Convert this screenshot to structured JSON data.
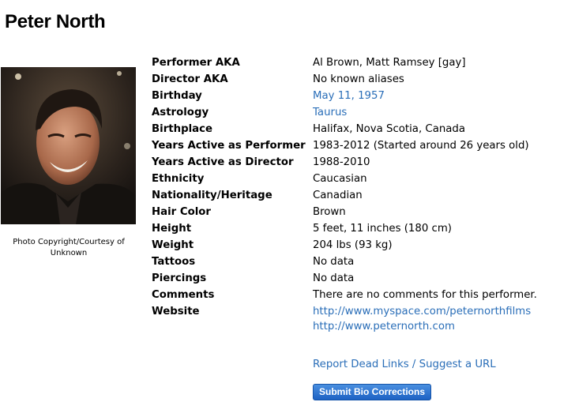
{
  "page": {
    "title": "Peter North"
  },
  "photo": {
    "caption": "Photo Copyright/Courtesy of Unknown"
  },
  "bio": [
    {
      "label": "Performer AKA",
      "value": "Al Brown, Matt Ramsey [gay]",
      "link": false
    },
    {
      "label": "Director AKA",
      "value": "No known aliases",
      "link": false
    },
    {
      "label": "Birthday",
      "value": "May 11, 1957",
      "link": true
    },
    {
      "label": "Astrology",
      "value": "Taurus",
      "link": true
    },
    {
      "label": "Birthplace",
      "value": "Halifax, Nova Scotia, Canada",
      "link": false
    },
    {
      "label": "Years Active as Performer",
      "value": "1983-2012 (Started around 26 years old)",
      "link": false
    },
    {
      "label": "Years Active as Director",
      "value": "1988-2010",
      "link": false
    },
    {
      "label": "Ethnicity",
      "value": "Caucasian",
      "link": false
    },
    {
      "label": "Nationality/Heritage",
      "value": "Canadian",
      "link": false
    },
    {
      "label": "Hair Color",
      "value": "Brown",
      "link": false
    },
    {
      "label": "Height",
      "value": "5 feet, 11 inches (180 cm)",
      "link": false
    },
    {
      "label": "Weight",
      "value": "204 lbs (93 kg)",
      "link": false
    },
    {
      "label": "Tattoos",
      "value": "No data",
      "link": false
    },
    {
      "label": "Piercings",
      "value": "No data",
      "link": false
    },
    {
      "label": "Comments",
      "value": "There are no comments for this performer.",
      "link": false
    }
  ],
  "website": {
    "label": "Website",
    "links": [
      "http://www.myspace.com/peternorthfilms",
      "http://www.peternorth.com"
    ]
  },
  "actions": {
    "report_dead_links": "Report Dead Links",
    "separator": " / ",
    "suggest_url": "Suggest a URL",
    "submit_label": "Submit Bio Corrections"
  },
  "colors": {
    "link": "#2a6eb8",
    "button": "#2f74d0"
  }
}
